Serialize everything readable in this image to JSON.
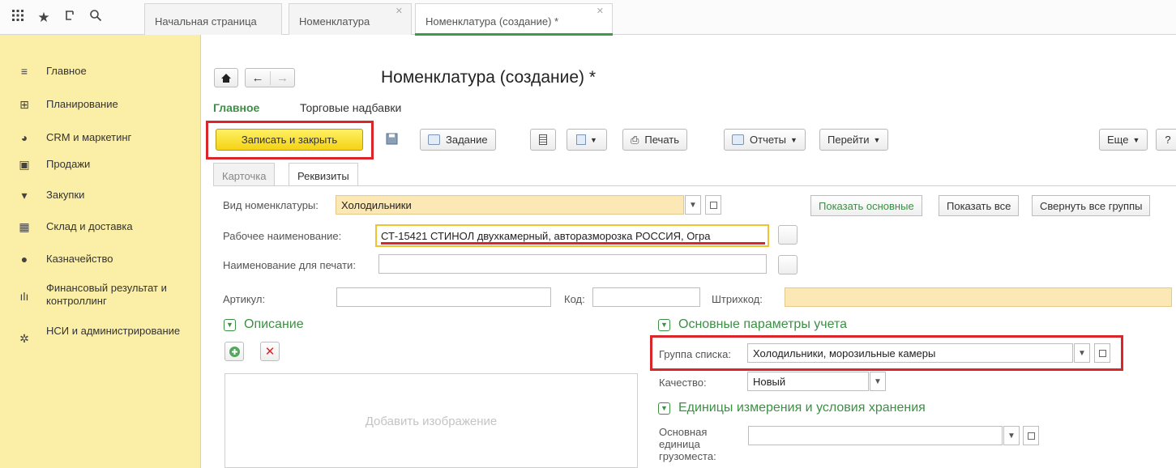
{
  "topbar": {
    "icons": [
      "apps-grid-icon",
      "star-icon",
      "history-icon",
      "search-icon"
    ],
    "tabs": [
      {
        "label": "Начальная страница",
        "closable": false
      },
      {
        "label": "Номенклатура",
        "closable": true
      },
      {
        "label": "Номенклатура (создание) *",
        "closable": true,
        "active": true
      }
    ]
  },
  "sidebar": {
    "items": [
      {
        "label": "Главное",
        "icon": "menu-lines-icon"
      },
      {
        "label": "Планирование",
        "icon": "planning-icon"
      },
      {
        "label": "CRM и маркетинг",
        "icon": "pie-chart-icon"
      },
      {
        "label": "Продажи",
        "icon": "shopping-bag-icon"
      },
      {
        "label": "Закупки",
        "icon": "cart-icon"
      },
      {
        "label": "Склад и доставка",
        "icon": "warehouse-icon"
      },
      {
        "label": "Казначейство",
        "icon": "ruble-coin-icon"
      },
      {
        "label": "Финансовый результат и контроллинг",
        "icon": "bar-chart-icon"
      },
      {
        "label": "НСИ и администрирование",
        "icon": "gear-icon"
      }
    ]
  },
  "form": {
    "title": "Номенклатура (создание) *",
    "sections": {
      "main": "Главное",
      "markups": "Торговые надбавки"
    },
    "toolbar": {
      "save_close": "Записать и закрыть",
      "task": "Задание",
      "print": "Печать",
      "reports": "Отчеты",
      "goto": "Перейти",
      "more": "Еще",
      "help": "?"
    },
    "tabs": {
      "card": "Карточка",
      "requisites": "Реквизиты"
    },
    "fields": {
      "kind_label": "Вид номенклатуры:",
      "kind_value": "Холодильники",
      "work_name_label": "Рабочее наименование:",
      "work_name_value": "СТ-15421 СТИНОЛ двухкамерный, авторазморозка РОССИЯ, Огра",
      "print_name_label": "Наименование для печати:",
      "print_name_value": "",
      "article_label": "Артикул:",
      "article_value": "",
      "code_label": "Код:",
      "code_value": "",
      "barcode_label": "Штрихкод:",
      "barcode_value": ""
    },
    "show_buttons": {
      "main": "Показать основные",
      "all": "Показать все",
      "collapse": "Свернуть все группы"
    },
    "description": {
      "header": "Описание",
      "add_image": "Добавить изображение"
    },
    "accounting": {
      "header": "Основные параметры учета",
      "group_label": "Группа списка:",
      "group_value": "Холодильники, морозильные камеры",
      "quality_label": "Качество:",
      "quality_value": "Новый"
    },
    "units": {
      "header": "Единицы измерения и условия хранения",
      "unit_label": "Основная единица грузоместа:",
      "unit_value": ""
    }
  },
  "colors": {
    "sidebar_bg": "#fbeea7",
    "accent_green": "#3d8f45",
    "primary_yellow": "#f4d315",
    "highlight_red": "#d9262b",
    "field_yellow": "#fbe8b5"
  }
}
